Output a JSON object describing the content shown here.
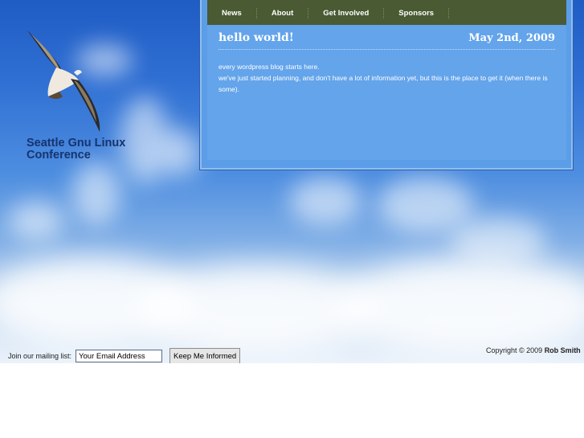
{
  "site": {
    "title_line1": "Seattle Gnu Linux",
    "title_line2": "Conference"
  },
  "nav": {
    "items": [
      "News",
      "About",
      "Get Involved",
      "Sponsors"
    ]
  },
  "post": {
    "title": "hello world!",
    "date": "May 2nd, 2009",
    "body_line1": "every wordpress blog starts here.",
    "body_line2": "we've just started planning, and don't have a lot of information yet, but this is the place to get it (when there is some)."
  },
  "mailing": {
    "label": "Join our mailing list:",
    "email_value": "Your Email Address",
    "button_label": "Keep Me Informed"
  },
  "footer": {
    "copyright": "Copyright © 2009",
    "author": "Rob Smith"
  },
  "colors": {
    "sky_top": "#1f5cc4",
    "nav_bg": "#4a5a32",
    "content_bg": "#63a4eb",
    "title_text": "#16346f"
  },
  "icons": {
    "logo": "seagull-icon"
  }
}
